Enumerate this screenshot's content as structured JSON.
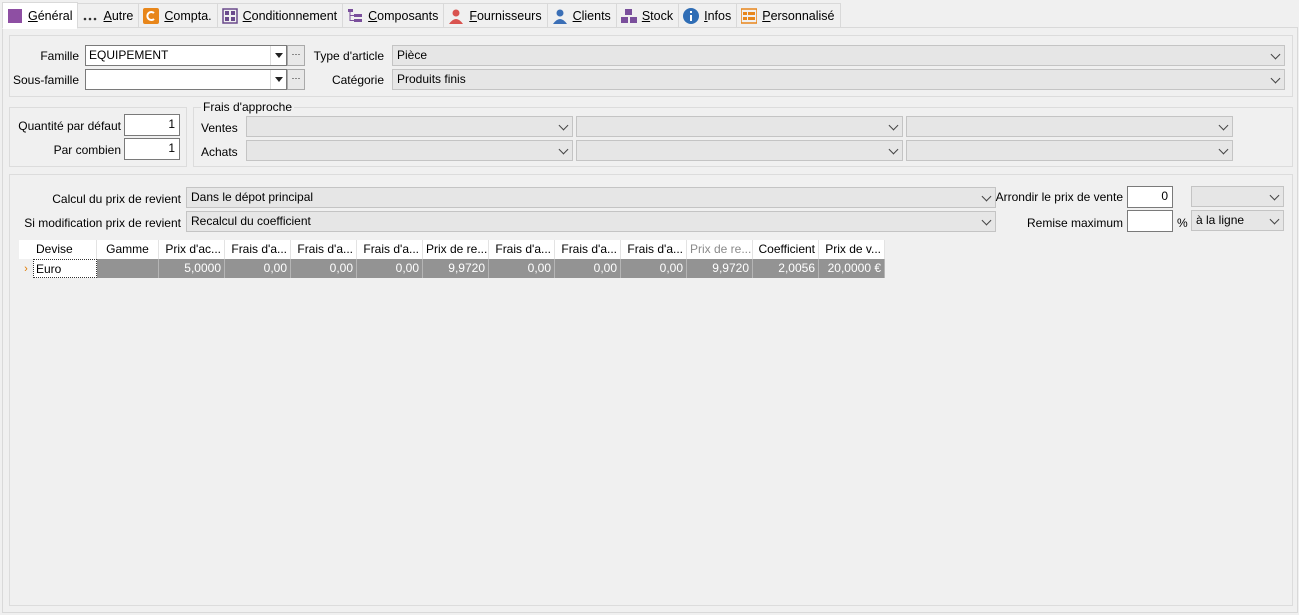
{
  "tabs": [
    {
      "label": "Général",
      "icon": "general-icon",
      "active": true
    },
    {
      "label": "Autre",
      "icon": "more-dots-icon"
    },
    {
      "label": "Compta.",
      "icon": "accounting-icon"
    },
    {
      "label": "Conditionnement",
      "icon": "packaging-grid-icon"
    },
    {
      "label": "Composants",
      "icon": "components-tree-icon"
    },
    {
      "label": "Fournisseurs",
      "icon": "supplier-person-icon"
    },
    {
      "label": "Clients",
      "icon": "client-person-icon"
    },
    {
      "label": "Stock",
      "icon": "stock-boxes-icon"
    },
    {
      "label": "Infos",
      "icon": "info-icon"
    },
    {
      "label": "Personnalisé",
      "icon": "custom-grid-icon"
    }
  ],
  "classification": {
    "famille_label": "Famille",
    "famille_value": "EQUIPEMENT",
    "sous_famille_label": "Sous-famille",
    "sous_famille_value": "",
    "type_article_label": "Type d'article",
    "type_article_value": "Pièce",
    "categorie_label": "Catégorie",
    "categorie_value": "Produits finis",
    "browse_label": "···"
  },
  "quantities": {
    "qte_defaut_label": "Quantité par défaut",
    "qte_defaut_value": "1",
    "par_combien_label": "Par combien",
    "par_combien_value": "1"
  },
  "frais_approche": {
    "legend": "Frais d'approche",
    "ventes_label": "Ventes",
    "achats_label": "Achats"
  },
  "pricing": {
    "calcul_label": "Calcul du prix de revient",
    "calcul_value": "Dans le dépot principal",
    "modif_label": "Si modification prix de revient",
    "modif_value": "Recalcul du coefficient",
    "arrondir_label": "Arrondir le prix de vente",
    "arrondir_value": "0",
    "arrondir_mode": "",
    "remise_label": "Remise maximum",
    "remise_value": "",
    "percent": "%",
    "remise_mode": "à la ligne"
  },
  "grid": {
    "columns": [
      "Devise",
      "Gamme",
      "Prix d'ac...",
      "Frais d'a...",
      "Frais d'a...",
      "Frais d'a...",
      "Prix de re...",
      "Frais d'a...",
      "Frais d'a...",
      "Frais d'a...",
      "Prix de re...",
      "Coefficient",
      "Prix de v..."
    ],
    "rows": [
      [
        "Euro",
        "",
        "5,0000",
        "0,00",
        "0,00",
        "0,00",
        "9,9720",
        "0,00",
        "0,00",
        "0,00",
        "9,9720",
        "2,0056",
        "20,0000 €"
      ]
    ],
    "row_marker": "›"
  },
  "colors": {
    "row_selected": "#939393",
    "tab_active_bg": "#ffffff",
    "accent_orange": "#e07b00"
  }
}
